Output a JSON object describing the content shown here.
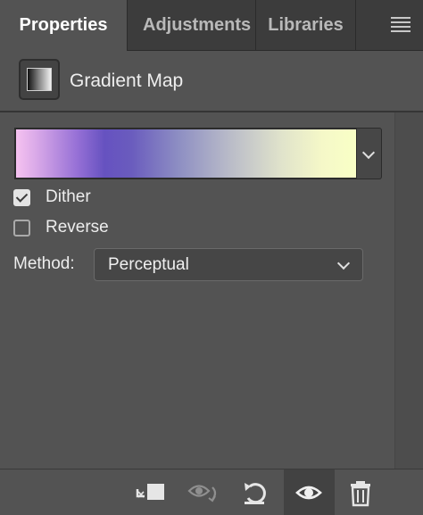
{
  "tabs": [
    {
      "label": "Properties",
      "active": true
    },
    {
      "label": "Adjustments",
      "active": false
    },
    {
      "label": "Libraries",
      "active": false
    }
  ],
  "header": {
    "title": "Gradient Map",
    "icon": "gradient-map-icon"
  },
  "gradient": {
    "stops": [
      "#f6c2f0",
      "#6652c0",
      "#b7b9c8",
      "#f9ffc6"
    ]
  },
  "options": {
    "dither": {
      "label": "Dither",
      "checked": true
    },
    "reverse": {
      "label": "Reverse",
      "checked": false
    }
  },
  "method": {
    "label": "Method:",
    "value": "Perceptual"
  },
  "footer": {
    "buttons": [
      "clip-to-layer-icon",
      "view-previous-state-icon",
      "reset-icon",
      "visibility-eye-icon",
      "trash-icon"
    ]
  },
  "colors": {
    "panel_bg": "#535353",
    "tabbar_bg": "#3c3c3c",
    "text": "#eaeaea"
  }
}
